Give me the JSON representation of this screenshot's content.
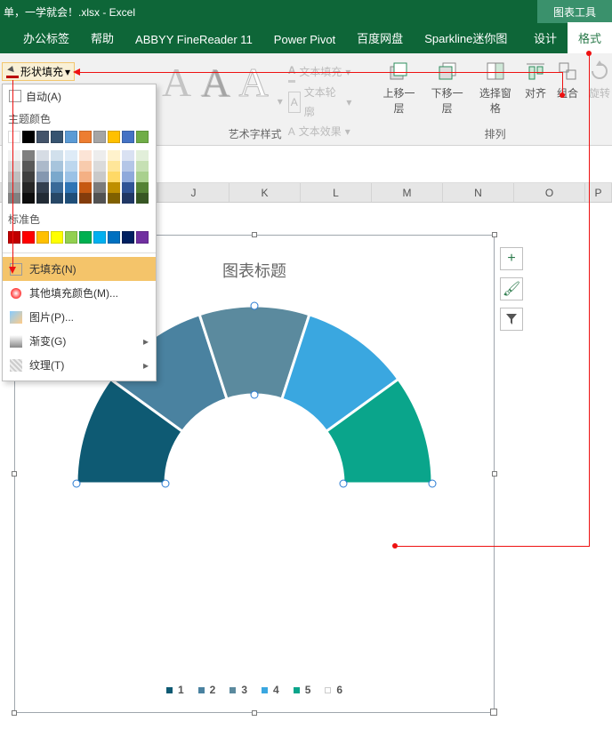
{
  "title": "单，一学就会！.xlsx  -  Excel",
  "chart_tools_label": "图表工具",
  "tabs": {
    "office": "办公标签",
    "help": "帮助",
    "abbyy": "ABBYY FineReader 11",
    "powerpivot": "Power Pivot",
    "baidu": "百度网盘",
    "sparkline": "Sparkline迷你图",
    "design": "设计",
    "format": "格式"
  },
  "shape_fill_label": "形状填充",
  "wordart": {
    "text_fill": "文本填充",
    "text_outline": "文本轮廓",
    "text_effects": "文本效果",
    "group_label": "艺术字样式"
  },
  "arrange": {
    "bring_forward": "上移一层",
    "send_backward": "下移一层",
    "selection_pane": "选择窗格",
    "align": "对齐",
    "group": "组合",
    "rotate": "旋转",
    "group_label": "排列"
  },
  "columns": [
    "J",
    "K",
    "L",
    "M",
    "N",
    "O",
    "P"
  ],
  "dropdown": {
    "auto": "自动(A)",
    "theme_colors": "主题颜色",
    "standard_colors": "标准色",
    "no_fill": "无填充(N)",
    "more_colors": "其他填充颜色(M)...",
    "picture": "图片(P)...",
    "gradient": "渐变(G)",
    "texture": "纹理(T)",
    "theme_row1": [
      "#ffffff",
      "#000000",
      "#44546a",
      "#375470",
      "#5b9bd5",
      "#ed7d31",
      "#a5a5a5",
      "#ffc000",
      "#4472c4",
      "#70ad47"
    ],
    "theme_grid": [
      [
        "#f2f2f2",
        "#7f7f7f",
        "#d6dce4",
        "#d1e0ec",
        "#deebf7",
        "#fce4d6",
        "#ededed",
        "#fff2cc",
        "#d9e1f2",
        "#e2efda"
      ],
      [
        "#d9d9d9",
        "#595959",
        "#acb9ca",
        "#a7c4dc",
        "#bdd7ee",
        "#f8cbad",
        "#dbdbdb",
        "#ffe699",
        "#b4c6e7",
        "#c6e0b4"
      ],
      [
        "#bfbfbf",
        "#404040",
        "#8497b0",
        "#7aa8cc",
        "#9bc2e6",
        "#f4b084",
        "#c9c9c9",
        "#ffd966",
        "#8ea9db",
        "#a9d08e"
      ],
      [
        "#a6a6a6",
        "#262626",
        "#333f4f",
        "#3a6a98",
        "#2f75b5",
        "#c65911",
        "#7b7b7b",
        "#bf8f00",
        "#305496",
        "#548235"
      ],
      [
        "#808080",
        "#0d0d0d",
        "#222b35",
        "#274766",
        "#1f4e78",
        "#833c0c",
        "#525252",
        "#806000",
        "#203764",
        "#375623"
      ]
    ],
    "standard": [
      "#c00000",
      "#ff0000",
      "#ffc000",
      "#ffff00",
      "#92d050",
      "#00b050",
      "#00b0f0",
      "#0070c0",
      "#002060",
      "#7030a0"
    ]
  },
  "chart_title": "图表标题",
  "chart_data": {
    "type": "pie",
    "note": "Half-doughnut (bottom half hidden). Six equal visible segments each correspond to legend entries 1-6; segment 6 is set to no-fill in this step.",
    "categories": [
      "1",
      "2",
      "3",
      "4",
      "5",
      "6"
    ],
    "values": [
      1,
      1,
      1,
      1,
      1,
      1
    ],
    "colors": [
      "#0e5a73",
      "#4a82a0",
      "#5b8a9e",
      "#3aa7e0",
      "#0aa58b",
      "transparent"
    ],
    "title": "图表标题"
  },
  "side_buttons": {
    "add": "+",
    "brush": "🖌",
    "filter": "▼"
  },
  "legend_items": [
    "1",
    "2",
    "3",
    "4",
    "5",
    "6"
  ]
}
